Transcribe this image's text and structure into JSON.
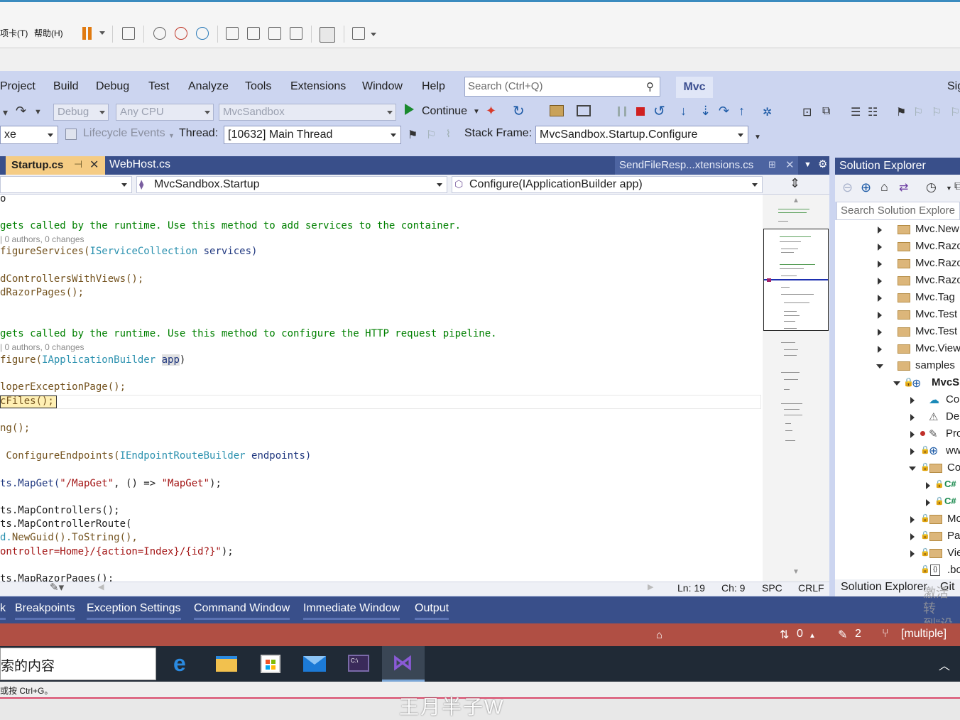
{
  "host": {
    "menu": [
      "项卡(T)",
      "帮助(H)"
    ]
  },
  "menubar": {
    "items": [
      "Project",
      "Build",
      "Debug",
      "Test",
      "Analyze",
      "Tools",
      "Extensions",
      "Window",
      "Help"
    ],
    "search_placeholder": "Search (Ctrl+Q)",
    "solution_badge": "Mvc",
    "sign_in": "Sig"
  },
  "toolbar1": {
    "config": "Debug",
    "platform": "Any CPU",
    "startup_project": "MvcSandbox",
    "continue_label": "Continue"
  },
  "toolbar2": {
    "process": "xe",
    "lifecycle_label": "Lifecycle Events",
    "thread_label": "Thread:",
    "thread_value": "[10632] Main Thread",
    "stack_label": "Stack Frame:",
    "stack_value": "MvcSandbox.Startup.Configure"
  },
  "tabs": {
    "active": "Startup.cs",
    "second": "WebHost.cs",
    "preview": "SendFileResp...xtensions.cs"
  },
  "navbar": {
    "type_combo": "MvcSandbox.Startup",
    "member_combo": "Configure(IApplicationBuilder app)"
  },
  "code": {
    "line1": "o",
    "comment1": "gets called by the runtime. Use this method to add services to the container.",
    "lens1": "| 0 authors, 0 changes",
    "sig1_name": "figureServices(",
    "sig1_type": "IServiceCollection",
    "sig1_param": " services)",
    "l_ctrl": "dControllersWithViews();",
    "l_razor": "dRazorPages();",
    "comment2": "gets called by the runtime. Use this method to configure the HTTP request pipeline.",
    "lens2": "| 0 authors, 0 changes",
    "sig2_name": "figure(",
    "sig2_type": "IApplicationBuilder",
    "sig2_param": "app",
    "sig2_end": ")",
    "l_dev": "loperExceptionPage();",
    "l_static": "cFiles();",
    "l_routing": "ng();",
    "l_cfg_name": " ConfigureEndpoints(",
    "l_cfg_type": "IEndpointRouteBuilder",
    "l_cfg_param": " endpoints)",
    "l_mapget_pre": "ts.MapGet(",
    "l_mapget_s1": "\"/MapGet\"",
    "l_mapget_mid": ", () => ",
    "l_mapget_s2": "\"MapGet\"",
    "l_mapget_end": ");",
    "l_mapctrl": "ts.MapControllers();",
    "l_maproute": "ts.MapControllerRoute(",
    "l_guid_pre": "d.",
    "l_guid": "NewGuid().ToString(),",
    "l_pattern_s": "ontroller=Home}/{action=Index}/{id?}\"",
    "l_pattern_end": ");",
    "l_razorpages": "ts.MapRazorPages();"
  },
  "editor_status": {
    "ln": "Ln: 19",
    "ch": "Ch: 9",
    "spc": "SPC",
    "crlf": "CRLF"
  },
  "solution_explorer": {
    "title": "Solution Explorer",
    "search_placeholder": "Search Solution Explore",
    "items": [
      "Mvc.New",
      "Mvc.Razo",
      "Mvc.Razo",
      "Mvc.Razo",
      "Mvc.Tag",
      "Mvc.Test",
      "Mvc.Test",
      "Mvc.View",
      "samples",
      "MvcS",
      "Co",
      "De",
      "Pro",
      "ww",
      "Co",
      "C#",
      "C#",
      "Mo",
      "Pa",
      "Vie",
      ".bo"
    ],
    "bottom_tab": "Solution Explorer",
    "bottom_tab2": "Git"
  },
  "bottom_tabs": [
    "k",
    "Breakpoints",
    "Exception Settings",
    "Command Window",
    "Immediate Window",
    "Output"
  ],
  "statusbar": {
    "arrows": "0",
    "edits": "2",
    "branch": "[multiple]"
  },
  "taskbar": {
    "search_text": "索的内容"
  },
  "hint": "或按 Ctrl+G。",
  "watermark": "王月半子W",
  "activate": [
    "激活",
    "转到“设"
  ]
}
